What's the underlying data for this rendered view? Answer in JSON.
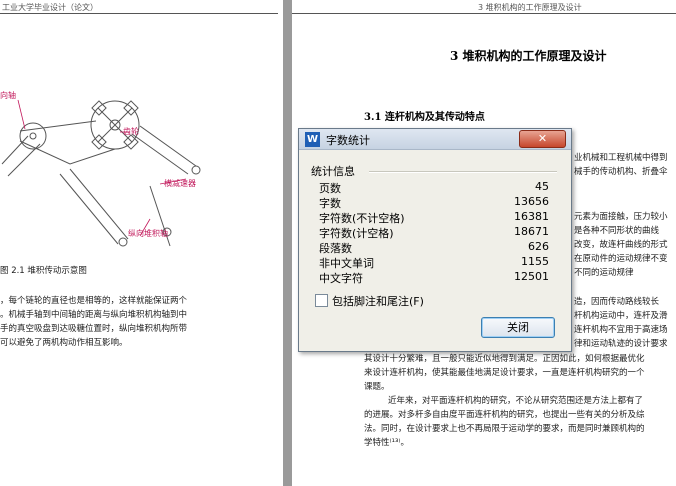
{
  "left_page": {
    "header": "工业大学毕业设计（论文）",
    "labels": {
      "shaft_top": "向轴",
      "gear": "齿轮",
      "reducer": "横减速器",
      "vertical_shaft": "纵向堆积轴"
    },
    "caption": "图 2.1 堆积传动示意图",
    "body_lines": [
      "，每个链轮的直径也是相等的，这样就能保证两个",
      "。机械手轴到中间轴的距离与纵向堆积机构轴到中",
      "手的真空吸盘到达吸糖位置时，纵向堆积机构所带",
      "可以避免了两机构动作相互影响。"
    ]
  },
  "right_page": {
    "header": "3  堆积机构的工作原理及设计",
    "chapter_title": "3 堆积机构的工作原理及设计",
    "section_title": "3.1  连杆机构及其传动特点",
    "fragments_right": [
      "业机械和工程机械中得到",
      "械手的传动机构、折叠伞",
      "",
      "元素为面接触，压力较小",
      "是各种不同形状的曲线",
      "改变，故连杆曲线的形式",
      "在原动件的运动规律不变",
      "不同的运动规律"
    ],
    "fragments_lower": [
      "造，因而传动路线较长",
      "杆机构运动中，连杆及滑",
      "连杆机构不宜用于高速场",
      "律和运动轨迹的设计要求"
    ],
    "body_lines": [
      "其设计十分繁难，且一般只能近似地得到满足。正因如此，如何根据最优化",
      "来设计连杆机构，使其能最佳地满足设计要求，一直是连杆机构研究的一个",
      "课题。",
      "近年来，对平面连杆机构的研究，不论从研究范围还是方法上都有了",
      "的进展。对多杆多自由度平面连杆机构的研究，也提出一些有关的分析及综",
      "法。同时，在设计要求上也不再局限于运动学的要求，而是同时兼顾机构的",
      "学特性⁽¹³⁾。"
    ]
  },
  "dialog": {
    "icon_letter": "W",
    "title": "字数统计",
    "close_symbol": "✕",
    "group_label": "统计信息",
    "stats": [
      {
        "label": "页数",
        "value": "45"
      },
      {
        "label": "字数",
        "value": "13656"
      },
      {
        "label": "字符数(不计空格)",
        "value": "16381"
      },
      {
        "label": "字符数(计空格)",
        "value": "18671"
      },
      {
        "label": "段落数",
        "value": "626"
      },
      {
        "label": "非中文单词",
        "value": "1155"
      },
      {
        "label": "中文字符",
        "value": "12501"
      }
    ],
    "checkbox_label": "包括脚注和尾注(F)",
    "checkbox_checked": false,
    "ok_label": "关闭"
  }
}
